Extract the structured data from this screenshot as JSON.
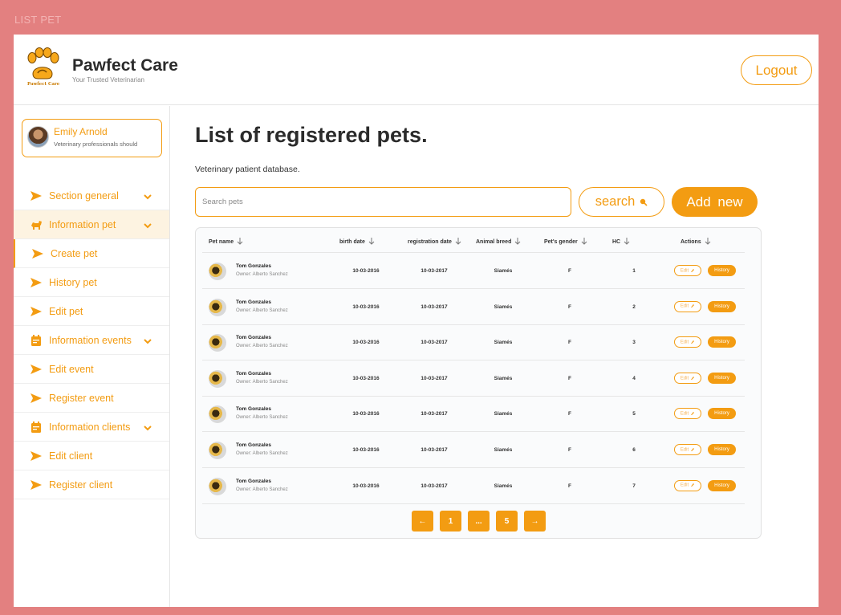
{
  "frame_label": "LIST PET",
  "header": {
    "logo_text": "Pawfect Care",
    "brand_name": "Pawfect Care",
    "brand_tagline": "Your Trusted Veterinarian",
    "logout_label": "Logout"
  },
  "profile": {
    "name": "Emily Arnold",
    "role": "Veterinary professionals should"
  },
  "sidebar": {
    "items": [
      {
        "label": "Section general",
        "icon": "send-arrow-icon",
        "expandable": true
      },
      {
        "label": "Information pet",
        "icon": "dog-icon",
        "expandable": true
      },
      {
        "label": "Create pet",
        "icon": "send-arrow-icon",
        "expandable": false
      },
      {
        "label": "History pet",
        "icon": "send-arrow-icon",
        "expandable": false
      },
      {
        "label": "Edit pet",
        "icon": "send-arrow-icon",
        "expandable": false
      },
      {
        "label": "Information events",
        "icon": "calendar-icon",
        "expandable": true
      },
      {
        "label": "Edit event",
        "icon": "send-arrow-icon",
        "expandable": false
      },
      {
        "label": "Register event",
        "icon": "send-arrow-icon",
        "expandable": false
      },
      {
        "label": "Information clients",
        "icon": "calendar-icon",
        "expandable": true
      },
      {
        "label": "Edit client",
        "icon": "send-arrow-icon",
        "expandable": false
      },
      {
        "label": "Register client",
        "icon": "send-arrow-icon",
        "expandable": false
      }
    ]
  },
  "main": {
    "title": "List of registered pets.",
    "subtitle": "Veterinary patient database.",
    "search_placeholder": "Search pets",
    "search_label": "search",
    "add_label": "Add  new"
  },
  "table": {
    "columns": [
      "Pet name",
      "birth date",
      "registration date",
      "Animal breed",
      "Pet's gender",
      "HC",
      "Actions"
    ],
    "edit_label": "Edit",
    "history_label": "History",
    "rows": [
      {
        "name": "Tom Gonzales",
        "owner": "Owner: Alberto Sanchez",
        "birth": "10-03-2016",
        "registration": "10-03-2017",
        "breed": "Siamés",
        "gender": "F",
        "hc": "1"
      },
      {
        "name": "Tom Gonzales",
        "owner": "Owner: Alberto Sanchez",
        "birth": "10-03-2016",
        "registration": "10-03-2017",
        "breed": "Siamés",
        "gender": "F",
        "hc": "2"
      },
      {
        "name": "Tom Gonzales",
        "owner": "Owner: Alberto Sanchez",
        "birth": "10-03-2016",
        "registration": "10-03-2017",
        "breed": "Siamés",
        "gender": "F",
        "hc": "3"
      },
      {
        "name": "Tom Gonzales",
        "owner": "Owner: Alberto Sanchez",
        "birth": "10-03-2016",
        "registration": "10-03-2017",
        "breed": "Siamés",
        "gender": "F",
        "hc": "4"
      },
      {
        "name": "Tom Gonzales",
        "owner": "Owner: Alberto Sanchez",
        "birth": "10-03-2016",
        "registration": "10-03-2017",
        "breed": "Siamés",
        "gender": "F",
        "hc": "5"
      },
      {
        "name": "Tom Gonzales",
        "owner": "Owner: Alberto Sanchez",
        "birth": "10-03-2016",
        "registration": "10-03-2017",
        "breed": "Siamés",
        "gender": "F",
        "hc": "6"
      },
      {
        "name": "Tom Gonzales",
        "owner": "Owner: Alberto Sanchez",
        "birth": "10-03-2016",
        "registration": "10-03-2017",
        "breed": "Siamés",
        "gender": "F",
        "hc": "7"
      }
    ]
  },
  "pagination": {
    "prev": "←",
    "first": "1",
    "ellipsis": "...",
    "last": "5",
    "next": "→"
  },
  "colors": {
    "accent": "#f39c12",
    "frame": "#e38080",
    "active_bg": "#fdf3e1"
  }
}
